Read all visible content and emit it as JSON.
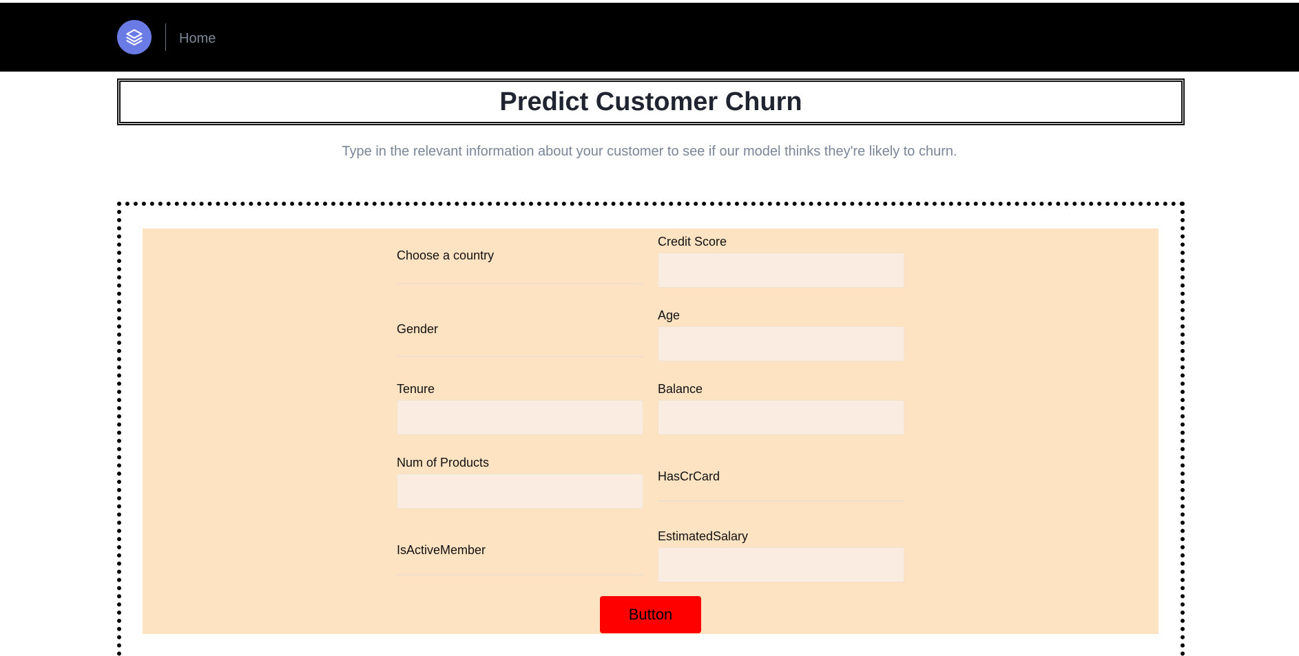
{
  "nav": {
    "logo_icon": "layers-icon",
    "logo_color": "#6b7be6",
    "home_label": "Home"
  },
  "page": {
    "title": "Predict Customer Churn",
    "subtitle": "Type in the relevant information about your customer to see if our model thinks they're likely to churn."
  },
  "form": {
    "country_label": "Choose a country",
    "credit_score_label": "Credit Score",
    "gender_label": "Gender",
    "age_label": "Age",
    "tenure_label": "Tenure",
    "balance_label": "Balance",
    "num_products_label": "Num of Products",
    "has_cr_card_label": "HasCrCard",
    "is_active_member_label": "IsActiveMember",
    "estimated_salary_label": "EstimatedSalary",
    "submit_label": "Button",
    "panel_color": "#fde3c2",
    "button_color": "#ff0000"
  }
}
